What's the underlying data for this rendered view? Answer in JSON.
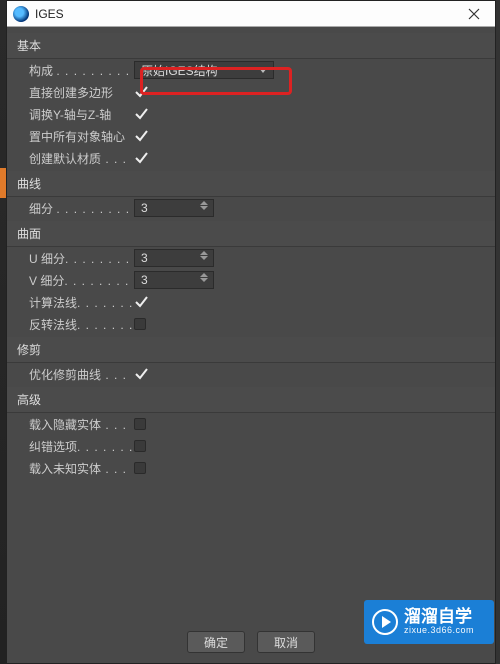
{
  "title": "IGES",
  "sections": {
    "basic": {
      "header": "基本",
      "compose_label": "构成",
      "compose_value": "原始IGES结构",
      "direct_poly": "直接创建多边形",
      "swap_yz": "调换Y-轴与Z-轴",
      "center_pivot": "置中所有对象轴心",
      "default_mat": "创建默认材质"
    },
    "curve": {
      "header": "曲线",
      "subdiv_label": "细分",
      "subdiv_value": "3"
    },
    "surface": {
      "header": "曲面",
      "u_label": "U 细分",
      "u_value": "3",
      "v_label": "V 细分",
      "v_value": "3",
      "calc_normal": "计算法线",
      "flip_normal": "反转法线"
    },
    "trim": {
      "header": "修剪",
      "optimize": "优化修剪曲线"
    },
    "advanced": {
      "header": "高级",
      "hidden": "载入隐藏实体",
      "error_opt": "纠错选项",
      "unknown": "载入未知实体"
    }
  },
  "buttons": {
    "ok": "确定",
    "cancel": "取消"
  },
  "watermark": {
    "brand": "溜溜自学",
    "sub": "zixue.3d66.com"
  }
}
